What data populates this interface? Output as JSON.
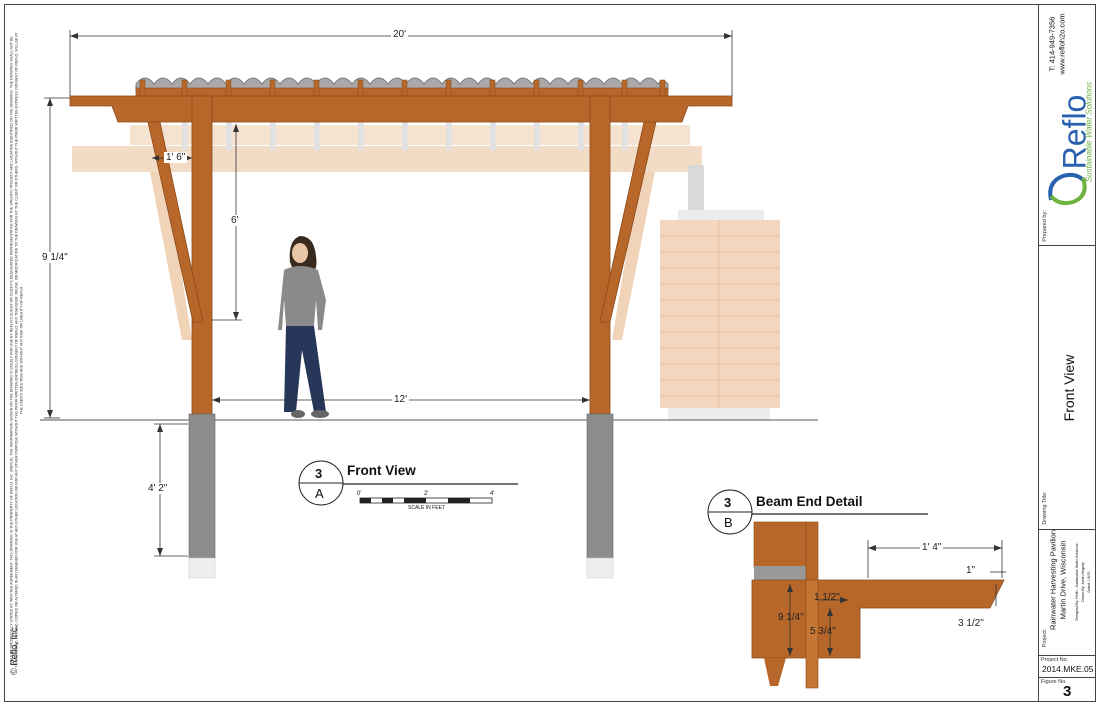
{
  "legal_notice": "UNLESS SPECIFICALLY STATED BY WRITTEN AGREEMENT, THIS DRAWING IS THE PROPERTY OF REFLO, INC. (REFLO). THE INFORMATION SHOWN ON THE DRAWING IS SOLELY FOR USE BY REFLO'S CLIENT OR CLIENT'S DESIGNATED REPRESENTATIVE FOR THE SPECIFIC PROJECT AND LOCATION IDENTIFIED ON THE DRAWING. THE DRAWING SHALL NOT BE TRANSFERRED, REUSED, COPIED OR ALTERED IN ANY MANNER FOR USE AT ANY OTHER LOCATION OR FOR ANY OTHER PURPOSE WITHOUT THE PRIOR WRITTEN EXPRESS CONSENT OF REFLO. ANY TRANSFER, REUSE, OR MODIFICATION TO THE DRAWING BY THE CLIENT OR OTHERS, WITHOUT THE PRIOR WRITTEN EXPRESS CONSENT OF REFLO, WILL BE AT THE USER'S SOLE RISK AND WITHOUT ANY RISK OR LIABILITY OF REFLO.",
  "copyright": "© Reflo, Inc.",
  "title_block": {
    "phone": "T: 414-949-7356",
    "website": "www.refloh2o.com",
    "logo_text": "Reflo",
    "logo_tagline": "Sustainable Water Solutions",
    "prepared_by_label": "Prepared by:",
    "drawing_title_label": "Drawing Title:",
    "drawing_title": "Front View",
    "project_label": "Project:",
    "project_name": "Rainwater Harvesting Pavilion",
    "project_location": "Martin Drive, Wisconsin",
    "designed_by": "Designed By: Reflo - Sustainable Water Solutions",
    "drawn_by": "Drawn By: Justin Hegarty",
    "dated": "Dated: 1/6/15",
    "project_no_label": "Project No.",
    "project_no": "2014.MKE.05",
    "figure_no_label": "Figure No.",
    "figure_no": "3"
  },
  "front_view": {
    "dims": {
      "width_total": "20'",
      "height_total": "9 1/4\"",
      "brace_offset": "1' 6\"",
      "brace_height": "6'",
      "post_spacing": "12'",
      "footing_depth": "4' 2\""
    },
    "callout_number": "3",
    "callout_sheet": "A",
    "title": "Front View",
    "scale_ticks": [
      "0'",
      "2'",
      "4'"
    ],
    "scale_label": "SCALE IN FEET"
  },
  "beam_detail": {
    "callout_number": "3",
    "callout_sheet": "B",
    "title": "Beam End Detail",
    "dims": {
      "overhang": "1' 4\"",
      "end_thickness": "1\"",
      "notch": "1 1/2\"",
      "beam_depth": "9 1/4\"",
      "inner_depth": "5 3/4\"",
      "end_depth": "3 1/2\""
    }
  },
  "colors": {
    "wood": "#b8672a",
    "wood_dark": "#8a4a1a",
    "concrete": "#8c8c8c",
    "roof": "#a9a9a9",
    "ghost_wood": "#f1d3b8",
    "accent_green": "#6db33f",
    "accent_blue": "#2a62b0"
  }
}
